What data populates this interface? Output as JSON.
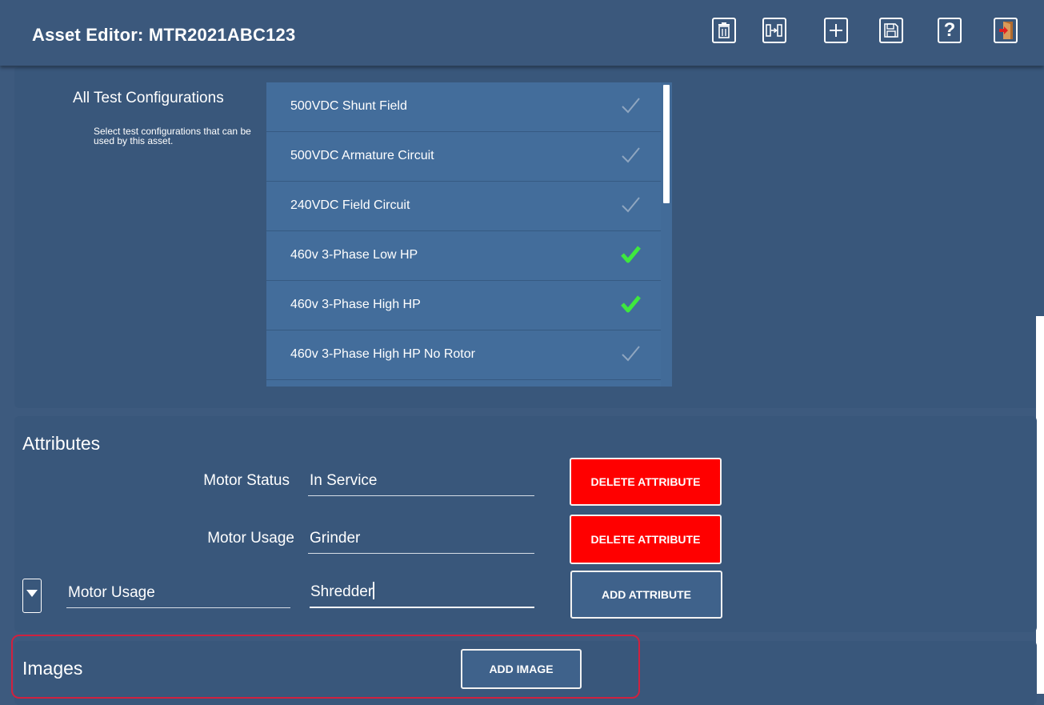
{
  "header": {
    "title": "Asset Editor: MTR2021ABC123",
    "toolbar": [
      "delete-icon",
      "move-icon",
      "add-icon",
      "save-icon",
      "help-icon",
      "exit-icon"
    ]
  },
  "configurations": {
    "label": "All Test Configurations",
    "help": "Select test configurations that can be used by this asset.",
    "items": [
      {
        "label": "500VDC Shunt Field",
        "checked": false
      },
      {
        "label": "500VDC Armature Circuit",
        "checked": false
      },
      {
        "label": "240VDC Field Circuit",
        "checked": false
      },
      {
        "label": "460v 3-Phase Low HP",
        "checked": true
      },
      {
        "label": "460v 3-Phase High HP",
        "checked": true
      },
      {
        "label": "460v 3-Phase High HP No Rotor",
        "checked": false
      }
    ],
    "colors": {
      "checked": "#3ee83e",
      "unchecked": "#8fa6c0"
    }
  },
  "attributes": {
    "title": "Attributes",
    "rows": [
      {
        "name": "Motor Status",
        "value": "In Service",
        "button": "DELETE ATTRIBUTE"
      },
      {
        "name": "Motor Usage",
        "value": "Grinder",
        "button": "DELETE ATTRIBUTE"
      }
    ],
    "new_row": {
      "name": "Motor Usage",
      "value": "Shredder",
      "button": "ADD ATTRIBUTE"
    }
  },
  "images": {
    "title": "Images",
    "button": "ADD IMAGE"
  }
}
